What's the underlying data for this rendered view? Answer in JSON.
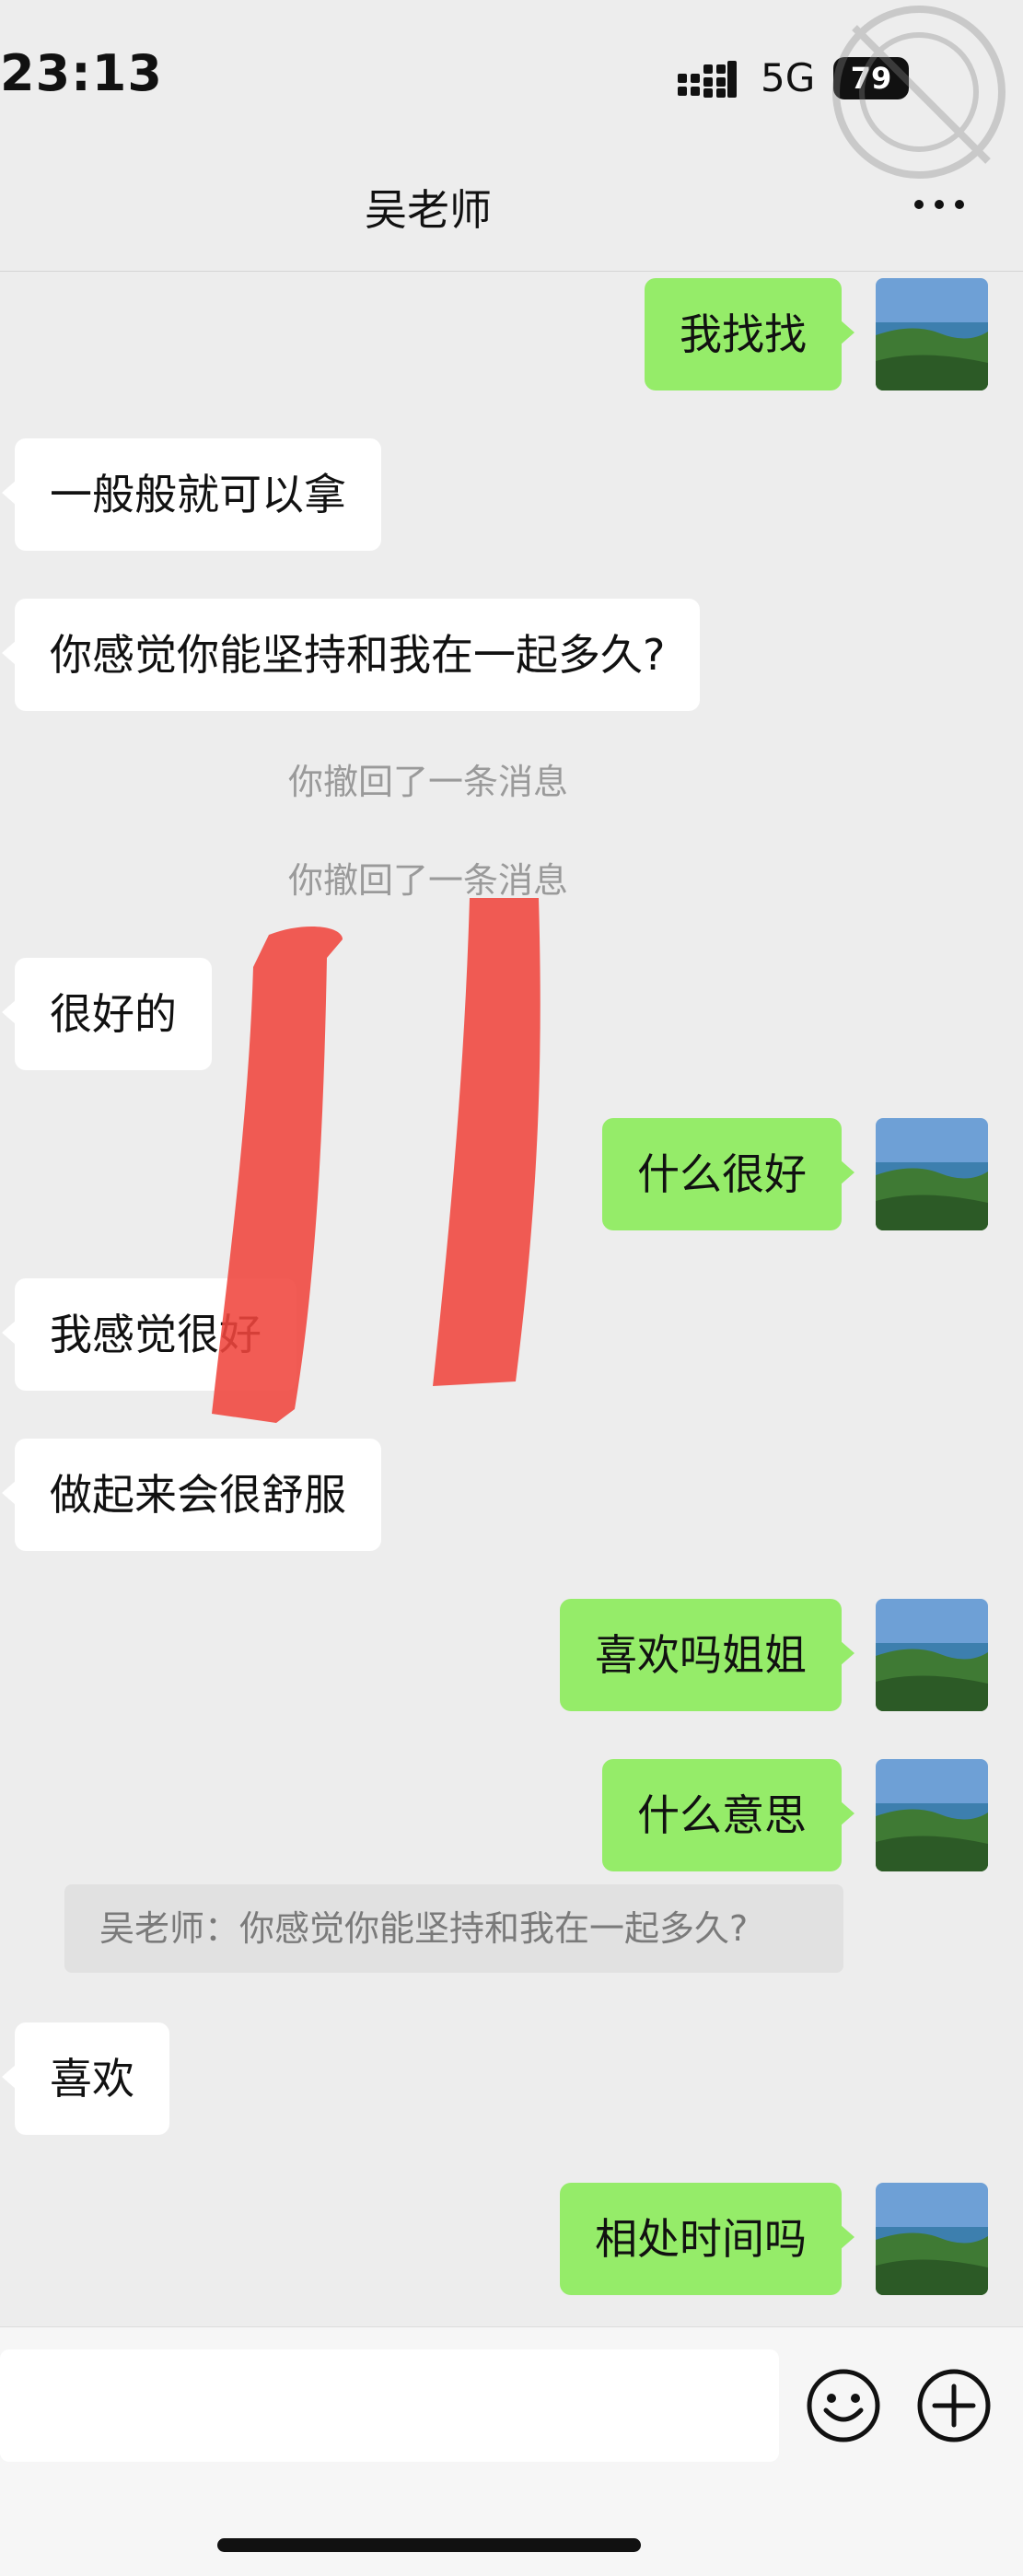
{
  "status_bar": {
    "time": "23:13",
    "network": "5G",
    "battery": "79",
    "signal_icon": "signal-bars-icon",
    "battery_icon": "battery-icon",
    "watermark_icon": "watermark-stamp-icon"
  },
  "header": {
    "title": "吴老师",
    "more_icon": "more-dots-icon"
  },
  "messages": [
    {
      "side": "right",
      "text": "我找找"
    },
    {
      "side": "left",
      "text": "一般般就可以拿"
    },
    {
      "side": "left",
      "text": "你感觉你能坚持和我在一起多久?"
    },
    {
      "side": "system",
      "text": "你撤回了一条消息"
    },
    {
      "side": "system",
      "text": "你撤回了一条消息"
    },
    {
      "side": "left",
      "text": "很好的"
    },
    {
      "side": "right",
      "text": "什么很好"
    },
    {
      "side": "left",
      "text": "我感觉很好"
    },
    {
      "side": "left",
      "text": "做起来会很舒服"
    },
    {
      "side": "right",
      "text": "喜欢吗姐姐"
    },
    {
      "side": "right",
      "text": "什么意思",
      "quote": "吴老师：你感觉你能坚持和我在一起多久?"
    },
    {
      "side": "left",
      "text": "喜欢"
    },
    {
      "side": "right",
      "text": "相处时间吗"
    }
  ],
  "input_bar": {
    "input_value": "",
    "emoji_icon": "emoji-smile-icon",
    "add_icon": "plus-circle-icon"
  },
  "colors": {
    "background": "#ededed",
    "sent_bubble": "#95ec69",
    "received_bubble": "#ffffff",
    "redaction_mark": "#f0453d"
  }
}
